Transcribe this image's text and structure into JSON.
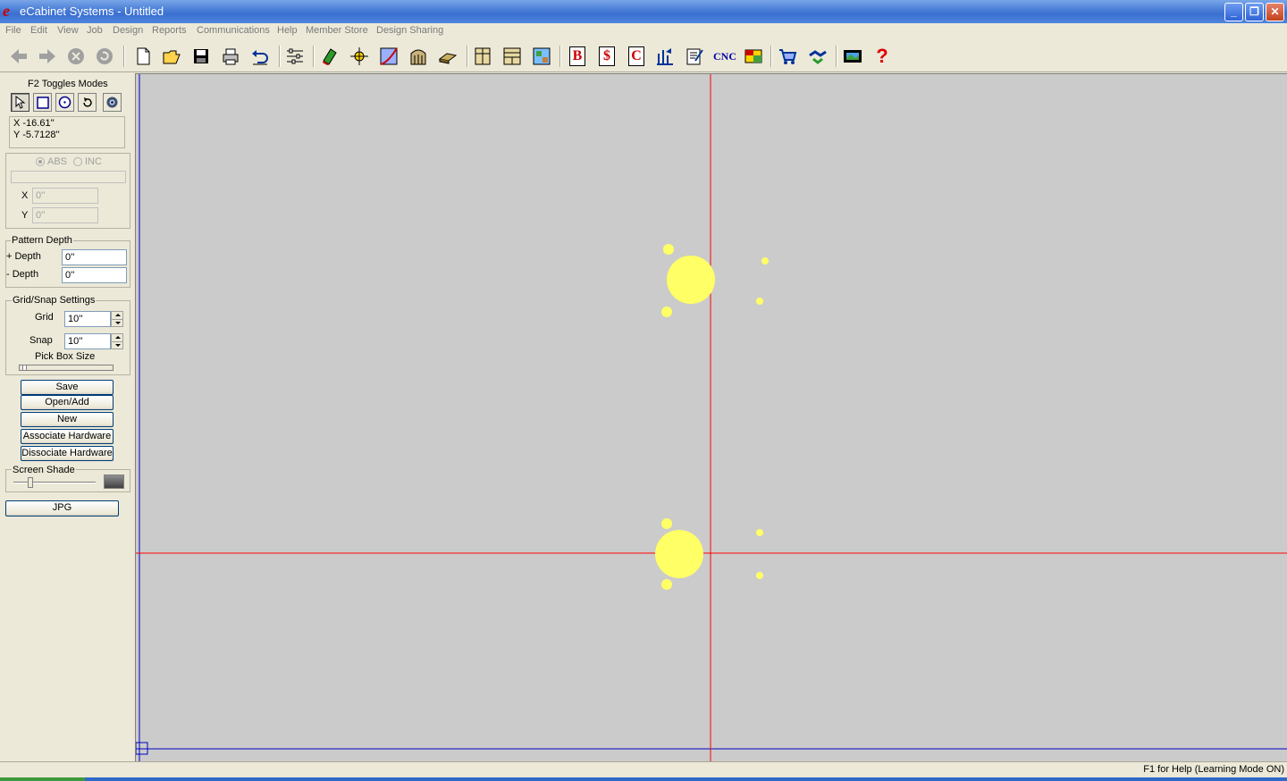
{
  "window": {
    "title": "eCabinet Systems - Untitled",
    "logo_glyph": "e",
    "minimize": "_",
    "restore": "❐",
    "close": "✕"
  },
  "menu": [
    "File",
    "Edit",
    "View",
    "Job",
    "Design",
    "Reports",
    "Communications",
    "Help",
    "Member Store",
    "Design Sharing"
  ],
  "toolbar": {
    "cnc_label": "CNC",
    "b_label": "B",
    "dollar_label": "$",
    "c_label": "C",
    "help_glyph": "?"
  },
  "left_panel": {
    "modes_title": "F2 Toggles Modes",
    "coord_x": "X -16.61''",
    "coord_y": "Y -5.7128''",
    "abs_label": "ABS",
    "inc_label": "INC",
    "x_label": "X",
    "y_label": "Y",
    "x_value": "0''",
    "y_value": "0''",
    "pattern_depth_title": "Pattern Depth",
    "plus_depth_label": "+ Depth",
    "minus_depth_label": "- Depth",
    "plus_depth_value": "0''",
    "minus_depth_value": "0''",
    "grid_snap_title": "Grid/Snap Settings",
    "grid_label": "Grid",
    "grid_value": "10''",
    "snap_label": "Snap",
    "snap_value": "10''",
    "pick_box_label": "Pick Box Size",
    "buttons": {
      "save": "Save",
      "open_add": "Open/Add",
      "new": "New",
      "associate": "Associate Hardware",
      "dissociate": "Dissociate Hardware"
    },
    "screen_shade_title": "Screen Shade",
    "jpg_button": "JPG"
  },
  "status": {
    "help_text": "F1 for Help (Learning Mode ON)"
  },
  "colors": {
    "canvas_bg": "#cbcbcb",
    "axis_red": "#ff0000",
    "border_blue": "#0000c0",
    "hole_yellow": "#ffff66"
  }
}
